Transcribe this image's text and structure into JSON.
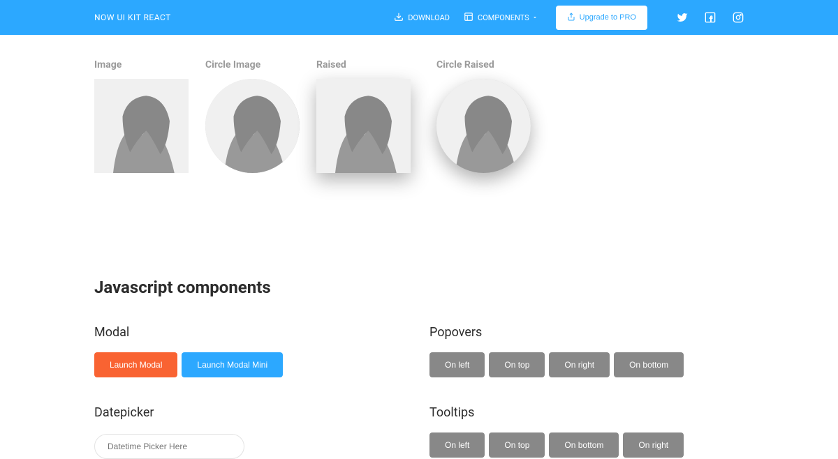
{
  "navbar": {
    "brand": "NOW UI KIT REACT",
    "download": "DOWNLOAD",
    "components": "COMPONENTS",
    "upgrade": "Upgrade to PRO"
  },
  "images": {
    "label_image": "Image",
    "label_circle": "Circle Image",
    "label_raised": "Raised",
    "label_circle_raised": "Circle Raised"
  },
  "section_js": "Javascript components",
  "modal": {
    "title": "Modal",
    "launch": "Launch Modal",
    "launch_mini": "Launch Modal Mini"
  },
  "datepicker": {
    "title": "Datepicker",
    "placeholder": "Datetime Picker Here"
  },
  "popovers": {
    "title": "Popovers",
    "left": "On left",
    "top": "On top",
    "right": "On right",
    "bottom": "On bottom"
  },
  "tooltips": {
    "title": "Tooltips",
    "left": "On left",
    "top": "On top",
    "bottom": "On bottom",
    "right": "On right"
  }
}
